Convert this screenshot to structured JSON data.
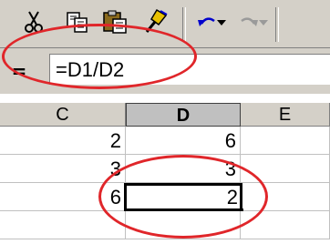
{
  "colors": {
    "chrome": "#d4d0c8",
    "annotation": "#e0262a",
    "cell_border": "#c0c0c0"
  },
  "toolbar": {
    "buttons": [
      {
        "name": "cut-icon"
      },
      {
        "name": "copy-icon"
      },
      {
        "name": "paste-icon"
      },
      {
        "name": "format-painter-icon"
      },
      {
        "name": "undo-icon"
      },
      {
        "name": "redo-icon",
        "disabled": true
      }
    ]
  },
  "formula_bar": {
    "equals_label": "=",
    "value": "=D1/D2"
  },
  "grid": {
    "columns": [
      "C",
      "D",
      "E"
    ],
    "active_column": "D",
    "rows": [
      {
        "C": "2",
        "D": "6",
        "E": ""
      },
      {
        "C": "3",
        "D": "3",
        "E": ""
      },
      {
        "C": "6",
        "D": "2",
        "E": ""
      },
      {
        "C": "",
        "D": "",
        "E": ""
      }
    ],
    "active_cell": "D3"
  }
}
